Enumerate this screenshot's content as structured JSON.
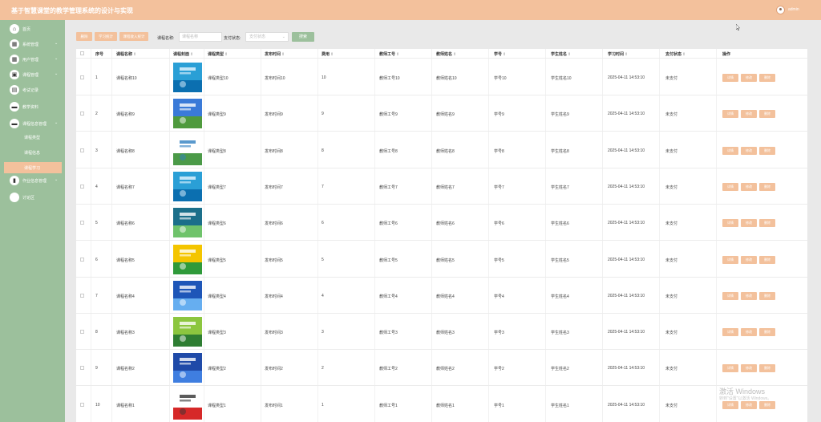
{
  "header": {
    "title": "基于智慧课堂的教学管理系统的设计与实现",
    "user": "admin"
  },
  "sidebar": {
    "items": [
      {
        "label": "首页",
        "icon": "home-icon",
        "glyph": "⌂",
        "has_arrow": false
      },
      {
        "label": "系统管理",
        "icon": "grid-icon",
        "glyph": "▦",
        "has_arrow": true
      },
      {
        "label": "用户管理",
        "icon": "users-icon",
        "glyph": "▦",
        "has_arrow": true
      },
      {
        "label": "课程管理",
        "icon": "book-icon",
        "glyph": "▣",
        "has_arrow": true
      },
      {
        "label": "考试记录",
        "icon": "exam-icon",
        "glyph": "▤",
        "has_arrow": false
      },
      {
        "label": "教学资料",
        "icon": "material-icon",
        "glyph": "▬",
        "has_arrow": false
      },
      {
        "label": "课程信息管理",
        "icon": "course-icon",
        "glyph": "▬",
        "has_arrow": true
      },
      {
        "label": "作业信息管理",
        "icon": "homework-icon",
        "glyph": "▮",
        "has_arrow": true
      },
      {
        "label": "讨论区",
        "icon": "forum-icon",
        "glyph": "",
        "has_arrow": false
      }
    ],
    "subitems": [
      "课程类型",
      "课程信息",
      "课程学习"
    ],
    "active_subitem": 2
  },
  "toolbar": {
    "buttons": [
      "删除",
      "学习统计",
      "课程收入统计"
    ],
    "search_label": "课程名称:",
    "search_placeholder": "课程名称",
    "status_label": "支付状态:",
    "status_placeholder": "支付状态",
    "search_button": "搜索"
  },
  "table": {
    "columns": [
      "序号",
      "课程名称",
      "课程封面",
      "课程类型",
      "发布时间",
      "费用",
      "教师工号",
      "教师姓名",
      "学号",
      "学生姓名",
      "学习时间",
      "支付状态",
      "操作"
    ],
    "sortable": [
      false,
      true,
      true,
      true,
      true,
      true,
      true,
      true,
      true,
      true,
      true,
      true,
      false
    ],
    "row_actions": [
      "详情",
      "修改",
      "删除"
    ],
    "rows": [
      {
        "index": "1",
        "name": "课程名称10",
        "type": "课程类型10",
        "time": "发布时间10",
        "fee": "10",
        "tno": "教师工号10",
        "tname": "教师姓名10",
        "sno": "学号10",
        "sname": "学生姓名10",
        "study_time": "2025-04-11 14:53:10",
        "status": "未支付",
        "cover": "blue"
      },
      {
        "index": "2",
        "name": "课程名称9",
        "type": "课程类型9",
        "time": "发布时间9",
        "fee": "9",
        "tno": "教师工号9",
        "tname": "教师姓名9",
        "sno": "学号9",
        "sname": "学生姓名9",
        "study_time": "2025-04-11 14:53:10",
        "status": "未支付",
        "cover": "campus"
      },
      {
        "index": "3",
        "name": "课程名称8",
        "type": "课程类型8",
        "time": "发布时间8",
        "fee": "8",
        "tno": "教师工号8",
        "tname": "教师姓名8",
        "sno": "学号8",
        "sname": "学生姓名8",
        "study_time": "2025-04-11 14:53:10",
        "status": "未支付",
        "cover": "book"
      },
      {
        "index": "4",
        "name": "课程名称7",
        "type": "课程类型7",
        "time": "发布时间7",
        "fee": "7",
        "tno": "教师工号7",
        "tname": "教师姓名7",
        "sno": "学号7",
        "sname": "学生姓名7",
        "study_time": "2025-04-11 14:53:10",
        "status": "未支付",
        "cover": "blue"
      },
      {
        "index": "5",
        "name": "课程名称6",
        "type": "课程类型6",
        "time": "发布时间6",
        "fee": "6",
        "tno": "教师工号6",
        "tname": "教师姓名6",
        "sno": "学号6",
        "sname": "学生姓名6",
        "study_time": "2025-04-11 14:53:10",
        "status": "未支付",
        "cover": "teal"
      },
      {
        "index": "6",
        "name": "课程名称5",
        "type": "课程类型5",
        "time": "发布时间5",
        "fee": "5",
        "tno": "教师工号5",
        "tname": "教师姓名5",
        "sno": "学号5",
        "sname": "学生姓名5",
        "study_time": "2025-04-11 14:53:10",
        "status": "未支付",
        "cover": "yellow"
      },
      {
        "index": "7",
        "name": "课程名称4",
        "type": "课程类型4",
        "time": "发布时间4",
        "fee": "4",
        "tno": "教师工号4",
        "tname": "教师姓名4",
        "sno": "学号4",
        "sname": "学生姓名4",
        "study_time": "2025-04-11 14:53:10",
        "status": "未支付",
        "cover": "darkblue"
      },
      {
        "index": "8",
        "name": "课程名称3",
        "type": "课程类型3",
        "time": "发布时间3",
        "fee": "3",
        "tno": "教师工号3",
        "tname": "教师姓名3",
        "sno": "学号3",
        "sname": "学生姓名3",
        "study_time": "2025-04-11 14:53:10",
        "status": "未支付",
        "cover": "green"
      },
      {
        "index": "9",
        "name": "课程名称2",
        "type": "课程类型2",
        "time": "发布时间2",
        "fee": "2",
        "tno": "教师工号2",
        "tname": "教师姓名2",
        "sno": "学号2",
        "sname": "学生姓名2",
        "study_time": "2025-04-11 14:53:10",
        "status": "未支付",
        "cover": "navy"
      },
      {
        "index": "10",
        "name": "课程名称1",
        "type": "课程类型1",
        "time": "发布时间1",
        "fee": "1",
        "tno": "教师工号1",
        "tname": "教师姓名1",
        "sno": "学号1",
        "sname": "学生姓名1",
        "study_time": "2025-04-11 14:53:10",
        "status": "未支付",
        "cover": "red"
      }
    ]
  },
  "watermark": {
    "line1": "激活 Windows",
    "line2": "转到\"设置\"以激活 Windows。"
  },
  "colors": {
    "header": "#f3c19c",
    "sidebar": "#9cc09c",
    "accent_button": "#f3c19c",
    "search_button": "#9cc09c"
  }
}
